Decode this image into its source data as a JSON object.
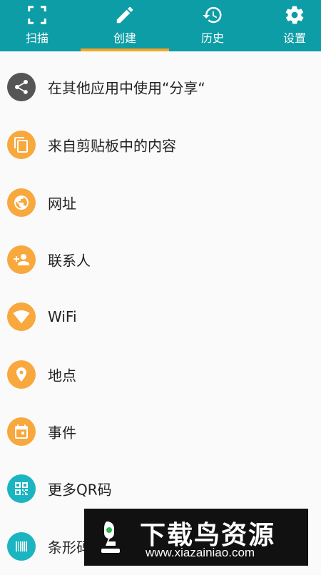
{
  "colors": {
    "header": "#0d9da6",
    "tab_indicator": "#f5a623",
    "share_icon_bg": "#555555",
    "orange_icon_bg": "#f8a83c",
    "teal_icon_bg": "#1bb5c1"
  },
  "tabs": [
    {
      "label": "扫描",
      "icon": "scan-icon"
    },
    {
      "label": "创建",
      "icon": "pencil-icon"
    },
    {
      "label": "历史",
      "icon": "history-icon"
    },
    {
      "label": "设置",
      "icon": "gear-icon"
    }
  ],
  "items": [
    {
      "label": "在其他应用中使用“分享“",
      "icon": "share-icon"
    },
    {
      "label": "来自剪贴板中的内容",
      "icon": "clipboard-icon"
    },
    {
      "label": "网址",
      "icon": "globe-icon"
    },
    {
      "label": "联系人",
      "icon": "add-contact-icon"
    },
    {
      "label": "WiFi",
      "icon": "wifi-icon"
    },
    {
      "label": "地点",
      "icon": "location-pin-icon"
    },
    {
      "label": "事件",
      "icon": "calendar-icon"
    },
    {
      "label": "更多QR码",
      "icon": "qr-code-icon"
    },
    {
      "label": "条形码",
      "icon": "barcode-icon"
    }
  ],
  "watermark": {
    "title": "下载鸟资源",
    "url": "www.xiazainiao.com"
  }
}
